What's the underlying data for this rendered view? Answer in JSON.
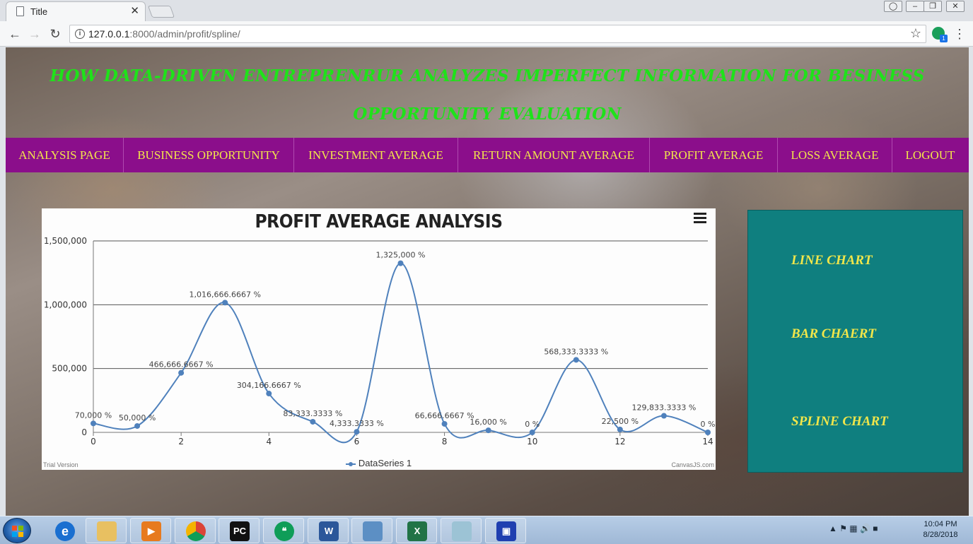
{
  "browser": {
    "tab_title": "Title",
    "tab_close": "✕",
    "url_host": "127.0.0.1",
    "url_path": ":8000/admin/profit/spline/",
    "extension_badge": "1"
  },
  "site": {
    "title_line1": "HOW DATA-DRIVEN ENTREPRENRUR ANALYZES IMPERFECT INFORMATION FOR BESINESS",
    "title_line2": "OPPORTUNITY EVALUATION"
  },
  "nav": {
    "items": [
      {
        "label": "ANALYSIS PAGE"
      },
      {
        "label": "BUSINESS OPPORTUNITY"
      },
      {
        "label": "INVESTMENT AVERAGE"
      },
      {
        "label": "RETURN AMOUNT AVERAGE"
      },
      {
        "label": "PROFIT AVERAGE"
      },
      {
        "label": "LOSS AVERAGE"
      },
      {
        "label": "LOGOUT"
      }
    ]
  },
  "chart_data": {
    "type": "line",
    "subtype": "spline",
    "title": "PROFIT AVERAGE ANALYSIS",
    "series": [
      {
        "name": "DataSeries 1",
        "color": "#4f81bc",
        "x": [
          0,
          1,
          2,
          3,
          4,
          5,
          6,
          7,
          8,
          9,
          10,
          11,
          12,
          13,
          14
        ],
        "values": [
          70000,
          50000,
          466666.6667,
          1016666.6667,
          304166.6667,
          83333.3333,
          4333.3333,
          1325000,
          66666.6667,
          16000,
          0,
          568333.3333,
          22500,
          129833.3333,
          0
        ],
        "labels": [
          "70,000 %",
          "50,000 %",
          "466,666.6667 %",
          "1,016,666.6667 %",
          "304,166.6667 %",
          "83,333.3333 %",
          "4,333.3333 %",
          "1,325,000 %",
          "66,666.6667 %",
          "16,000 %",
          "0 %",
          "568,333.3333 %",
          "22,500 %",
          "129,833.3333 %",
          "0 %"
        ]
      }
    ],
    "xlim": [
      0,
      14
    ],
    "ylim": [
      0,
      1500000
    ],
    "xticks": [
      0,
      2,
      4,
      6,
      8,
      10,
      12,
      14
    ],
    "yticks": [
      0,
      500000,
      1000000,
      1500000
    ],
    "ytick_labels": [
      "0",
      "500,000",
      "1,000,000",
      "1,500,000"
    ],
    "grid": true,
    "legend": "bottom",
    "trial_text": "Trial Version",
    "credit_text": "CanvasJS.com"
  },
  "side_panel": {
    "links": [
      {
        "label": "LINE CHART"
      },
      {
        "label": "BAR CHAERT"
      },
      {
        "label": "SPLINE CHART"
      }
    ]
  },
  "taskbar": {
    "time": "10:04 PM",
    "date": "8/28/2018"
  }
}
